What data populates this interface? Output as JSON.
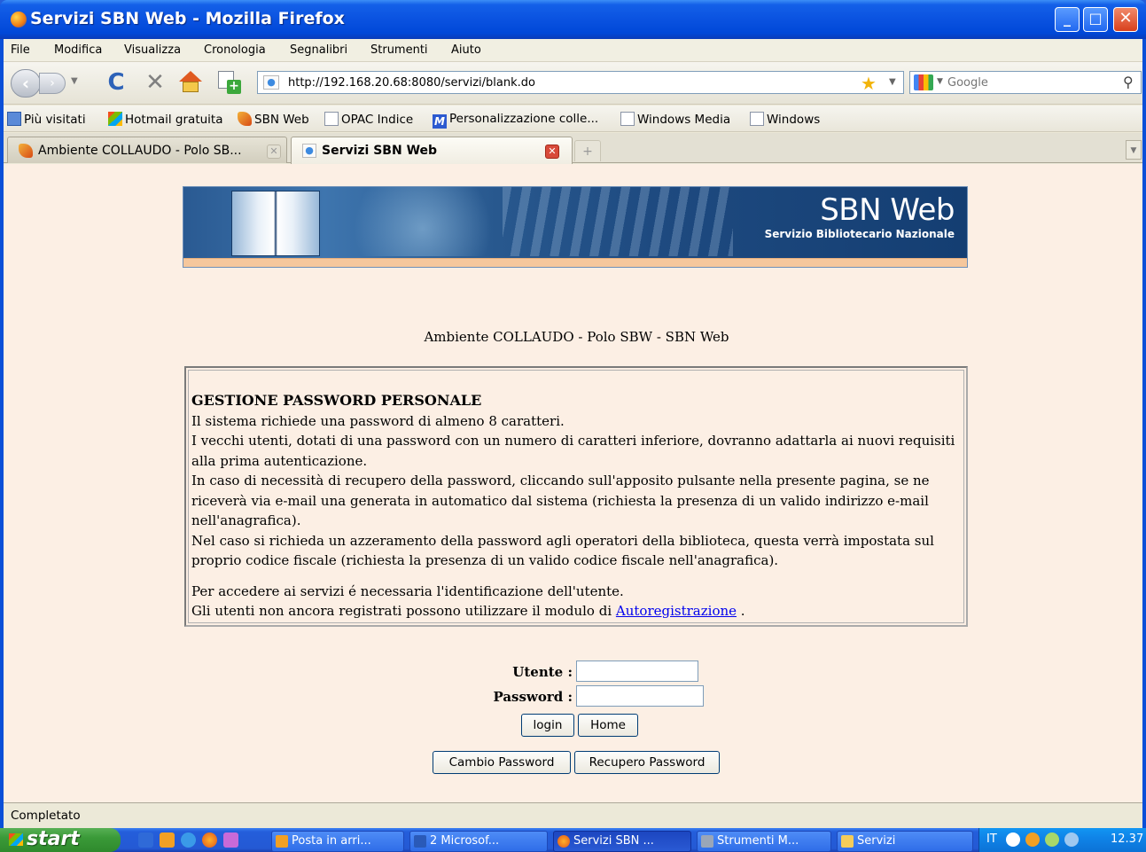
{
  "window": {
    "title": "Servizi SBN Web - Mozilla Firefox",
    "minimize": "_",
    "maximize": "□",
    "close": "✕"
  },
  "menubar": [
    "File",
    "Modifica",
    "Visualizza",
    "Cronologia",
    "Segnalibri",
    "Strumenti",
    "Aiuto"
  ],
  "navbar": {
    "url": "http://192.168.20.68:8080/servizi/blank.do",
    "search_placeholder": "Google"
  },
  "bookmarks": [
    "Più visitati",
    "Hotmail gratuita",
    "SBN Web",
    "OPAC Indice",
    "Personalizzazione colle...",
    "Windows Media",
    "Windows"
  ],
  "tabs": [
    {
      "label": "Ambiente COLLAUDO - Polo SB..."
    },
    {
      "label": "Servizi SBN Web"
    }
  ],
  "banner": {
    "brand": "SBN Web",
    "subtitle": "Servizio Bibliotecario Nazionale"
  },
  "environment": "Ambiente COLLAUDO - Polo SBW - SBN Web",
  "info": {
    "heading": "GESTIONE PASSWORD PERSONALE",
    "lines": [
      "Il sistema richiede una password di almeno 8 caratteri.",
      "I vecchi utenti, dotati di una password con un numero di caratteri inferiore, dovranno adattarla ai nuovi requisiti alla prima autenticazione.",
      "In caso di necessità di recupero della password, cliccando sull'apposito pulsante nella presente pagina, se ne riceverà via e-mail una generata in automatico dal sistema (richiesta la presenza di un valido indirizzo e-mail nell'anagrafica).",
      "Nel caso si richieda un azzeramento della password agli operatori della biblioteca, questa verrà impostata sul proprio codice fiscale (richiesta la presenza di un valido codice fiscale nell'anagrafica)."
    ],
    "access_line": "Per accedere ai servizi é necessaria l'identificazione dell'utente.",
    "register_prefix": "Gli utenti non ancora registrati possono utilizzare il modulo di",
    "register_link": "Autoregistrazione",
    "register_suffix": "."
  },
  "login": {
    "user_label": "Utente :",
    "password_label": "Password :",
    "user_value": "",
    "password_value": "",
    "login_button": "login",
    "home_button": "Home",
    "change_password_button": "Cambio Password",
    "recover_password_button": "Recupero Password"
  },
  "status": "Completato",
  "taskbar": {
    "start": "start",
    "tasks": [
      "Posta in arri...",
      "2 Microsof...",
      "Servizi SBN ...",
      "Strumenti M...",
      "Servizi"
    ],
    "language": "IT",
    "clock": "12.37"
  }
}
